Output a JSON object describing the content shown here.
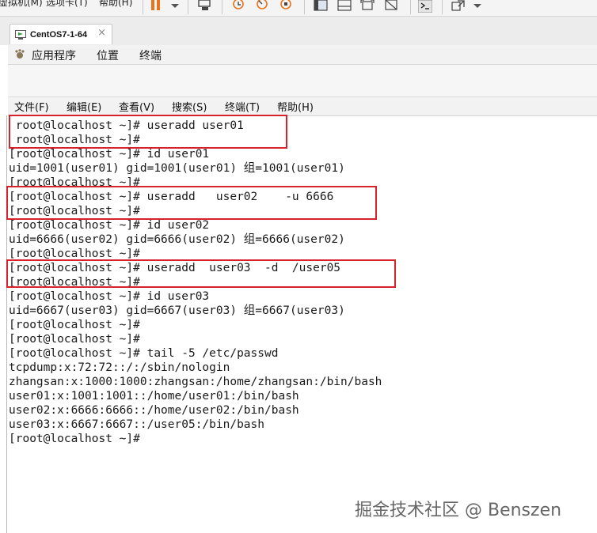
{
  "vm_menu": {
    "items": [
      "虚拟机(M)",
      "选项卡(T)",
      "帮助(H)"
    ]
  },
  "vm_tab": {
    "title": "CentOS7-1-64",
    "close": "×"
  },
  "gnome_bar": {
    "applications": "应用程序",
    "places": "位置",
    "terminal": "终端"
  },
  "terminal_menu": {
    "items": [
      "文件(F)",
      "编辑(E)",
      "查看(V)",
      "搜索(S)",
      "终端(T)",
      "帮助(H)"
    ]
  },
  "terminal": {
    "lines": [
      " root@localhost ~]# useradd user01",
      " root@localhost ~]#",
      "[root@localhost ~]# id user01",
      "uid=1001(user01) gid=1001(user01) 组=1001(user01)",
      "[root@localhost ~]#",
      "[root@localhost ~]# useradd   user02    -u 6666",
      "[root@localhost ~]#",
      "[root@localhost ~]# id user02",
      "uid=6666(user02) gid=6666(user02) 组=6666(user02)",
      "[root@localhost ~]#",
      "[root@localhost ~]# useradd  user03  -d  /user05",
      "[root@localhost ~]#",
      "[root@localhost ~]# id user03",
      "uid=6667(user03) gid=6667(user03) 组=6667(user03)",
      "[root@localhost ~]#",
      "[root@localhost ~]#",
      "[root@localhost ~]# tail -5 /etc/passwd",
      "tcpdump:x:72:72::/:/sbin/nologin",
      "zhangsan:x:1000:1000:zhangsan:/home/zhangsan:/bin/bash",
      "user01:x:1001:1001::/home/user01:/bin/bash",
      "user02:x:6666:6666::/home/user02:/bin/bash",
      "user03:x:6667:6667::/user05:/bin/bash",
      "[root@localhost ~]#"
    ]
  },
  "watermark": "掘金技术社区 @ Benszen",
  "colors": {
    "highlight": "#d6232b",
    "terminal_text": "#1a1a1a",
    "background": "#ffffff"
  }
}
